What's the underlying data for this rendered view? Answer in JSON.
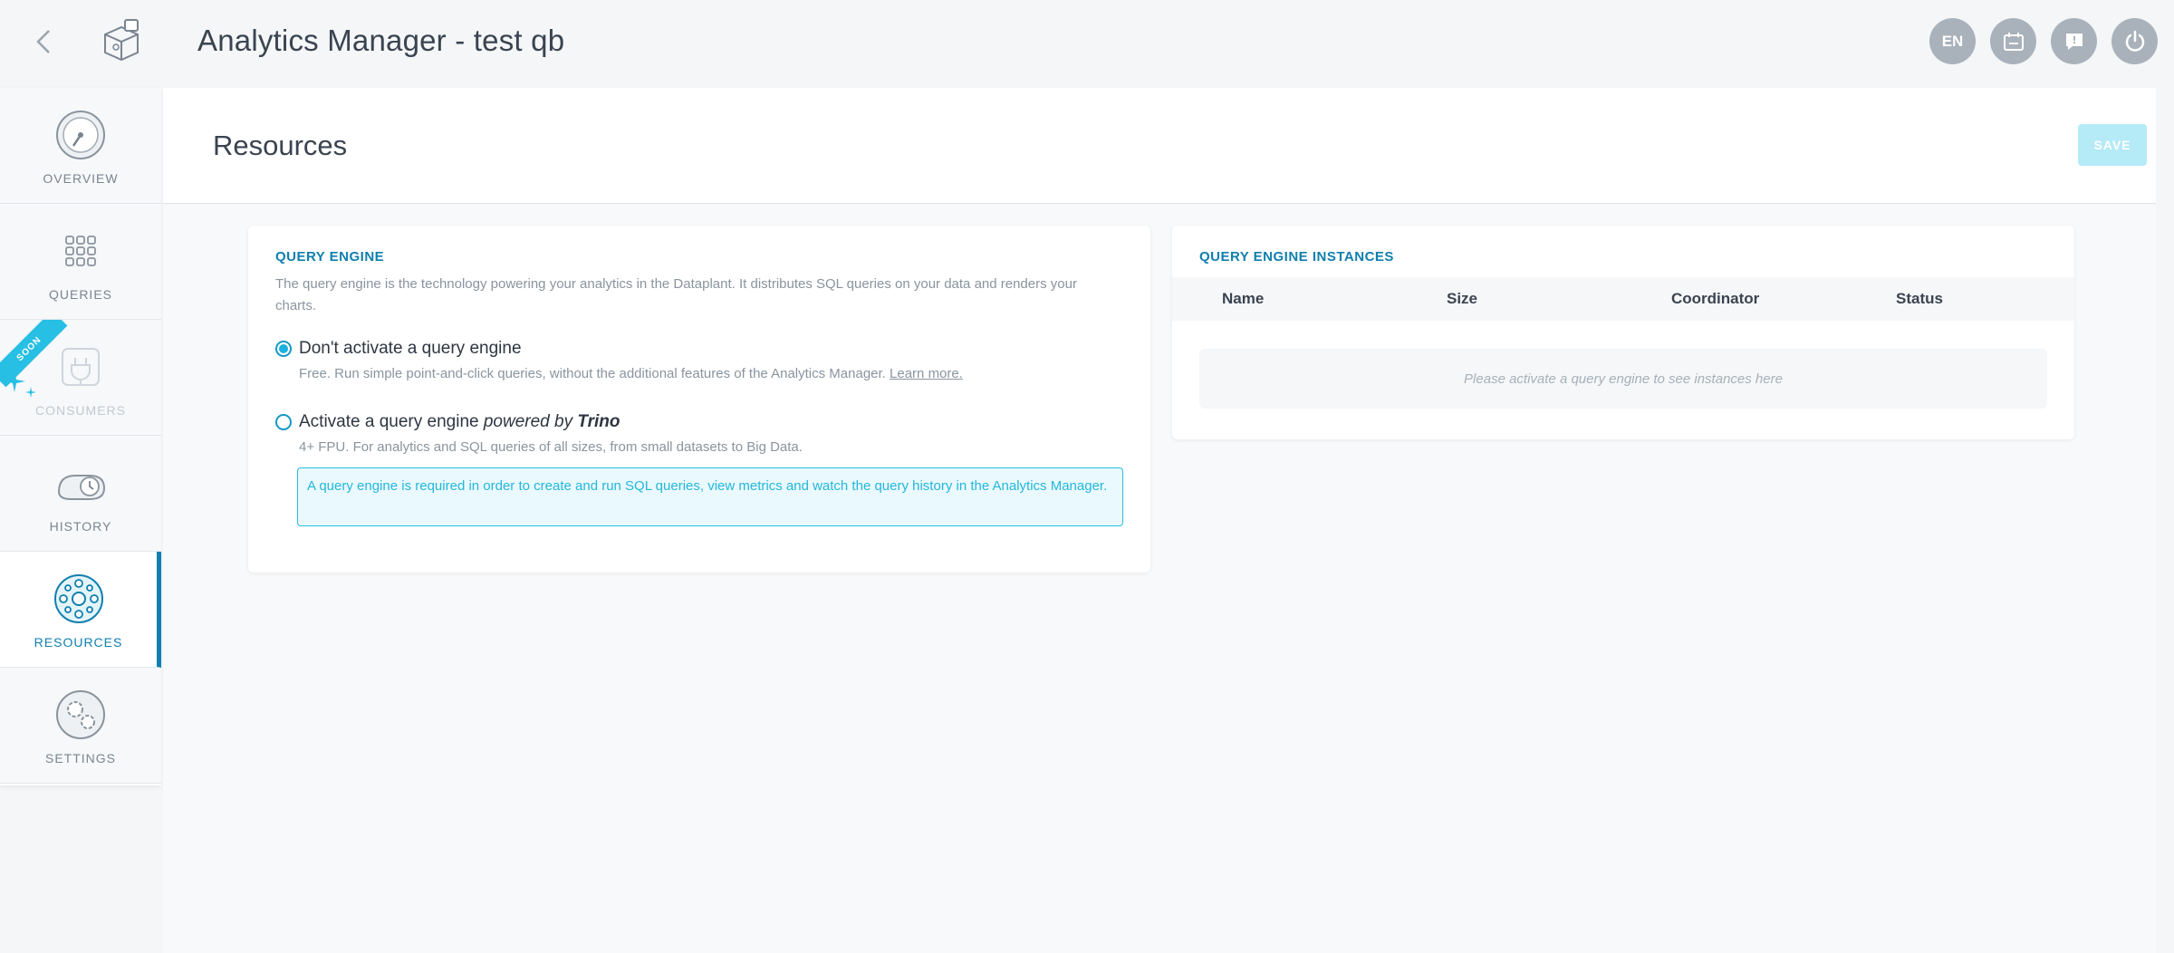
{
  "topbar": {
    "title": "Analytics Manager - test qb",
    "actions": [
      {
        "name": "language-button",
        "label": "EN"
      },
      {
        "name": "calendar-button",
        "label": ""
      },
      {
        "name": "help-button",
        "label": ""
      },
      {
        "name": "power-button",
        "label": ""
      }
    ]
  },
  "sidebar": {
    "items": [
      {
        "label": "OVERVIEW",
        "icon": "gauge-icon",
        "state": "normal"
      },
      {
        "label": "QUERIES",
        "icon": "grid-icon",
        "state": "normal"
      },
      {
        "label": "CONSUMERS",
        "icon": "plug-icon",
        "state": "disabled",
        "ribbon": "SOON"
      },
      {
        "label": "HISTORY",
        "icon": "history-icon",
        "state": "normal"
      },
      {
        "label": "RESOURCES",
        "icon": "resources-icon",
        "state": "active"
      },
      {
        "label": "SETTINGS",
        "icon": "gears-icon",
        "state": "normal"
      }
    ]
  },
  "header": {
    "title": "Resources",
    "save_label": "SAVE"
  },
  "query_engine": {
    "title": "QUERY ENGINE",
    "description": "The query engine is the technology powering your analytics in the Dataplant. It distributes SQL queries on your data and renders your charts.",
    "option1": {
      "label": "Don't activate a query engine",
      "sub": "Free. Run simple point-and-click queries, without the additional features of the Analytics Manager.",
      "link": "Learn more.",
      "selected": true
    },
    "option2": {
      "label_prefix": "Activate a query engine",
      "label_powered": "powered by",
      "label_brand": "Trino",
      "sub": "4+ FPU. For analytics and SQL queries of all sizes, from small datasets to Big Data.",
      "selected": false
    },
    "info": "A query engine is required in order to create and run SQL queries, view metrics and watch the query history in the Analytics Manager."
  },
  "instances": {
    "title": "QUERY ENGINE INSTANCES",
    "columns": [
      "Name",
      "Size",
      "Coordinator",
      "Status"
    ],
    "empty": "Please activate a query engine to see instances here"
  },
  "colors": {
    "accent": "#0f7fae",
    "highlight": "#27bfe3",
    "save_disabled": "#b5eaf7"
  }
}
